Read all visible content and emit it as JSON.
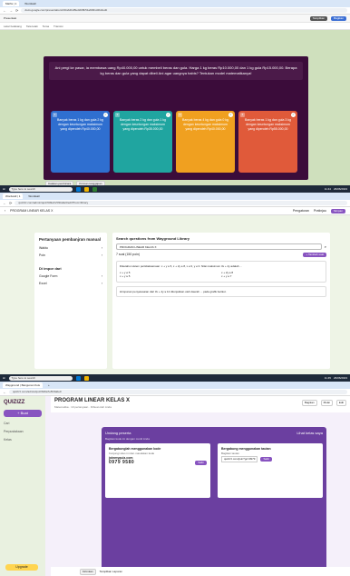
{
  "p1": {
    "tabs": [
      "Maths | 1",
      "Wordwall"
    ],
    "url": "docs.google.com/presentation/d/1fab4bdf9e0db8b51a8d91d4bd/edit",
    "slidebar": {
      "left": "Presentasi",
      "share": "Bagikan",
      "slideshow": "Tampilkan"
    },
    "toolbar": [
      "Latar belakang",
      "Tata letak",
      "Tema",
      "Transisi"
    ],
    "question": "Ani pergi ke pasar, ia membawa uang Rp40.000,00 untuk membeli beras dan gula. Harga 1 kg beras Rp10.000,00 dan 1 kg gula Rp15.000,00. Berapa kg beras dan gula yang dapat dibeli Ani agar uangnya habis? Tentukan model matematikanya!",
    "cards": [
      {
        "num": "1",
        "text": "Banyak beras 1 kg dan gula 2 kg dengan keuntungan maksimum yang diperoleh Rp40.000,00",
        "color": "#2f6fd0"
      },
      {
        "num": "2",
        "text": "Banyak beras 2 kg dan gula 1 kg dengan keuntungan maksimum yang diperoleh Rp35.000,00",
        "color": "#20a5a0"
      },
      {
        "num": "3",
        "text": "Banyak beras 4 kg dan gula 0 kg dengan keuntungan maksimum yang diperoleh Rp40.000,00",
        "color": "#f0a020"
      },
      {
        "num": "4",
        "text": "Banyak beras 1 kg dan gula 3 kg dengan keuntungan maksimum yang diperoleh Rp55.000,00",
        "color": "#e05a3a"
      }
    ],
    "footer": [
      "Catatan pembicara",
      "Kiriman tanggapan"
    ],
    "taskbar": {
      "search": "Type here to search",
      "time": "11:44",
      "date": "26/06/2023"
    }
  },
  "p2": {
    "tabs": [
      "Wordwall | 1",
      "Wordwall"
    ],
    "url": "quizizz.com/admin/quiz/649a7e5f1fa0e0/edit?from=library",
    "head": {
      "title": "PROGRAM LINEAR KELAS X",
      "right": [
        "Pengaturan",
        "Pratinjau",
        "Simpan"
      ]
    },
    "side": {
      "title": "Pertanyaan pembanjran manual",
      "rows": [
        {
          "l": "Waktu",
          "v": "›"
        },
        {
          "l": "Poin",
          "v": "›"
        }
      ],
      "importTitle": "Di impor dari",
      "imports": [
        "Google Form",
        "Excel"
      ]
    },
    "search": {
      "heading": "Search questions from Wayground Library",
      "placeholder": "PROGRAM LINEAR KELAS X",
      "results": "7 soal (150 poin)",
      "add": "+ Tambah soal"
    },
    "questions": [
      {
        "text": "Diketahui sistem pertidaksamaan: x + y ≤ 5, x + 2y ≤ 8, x ≥ 0, y ≥ 0. Nilai maksimum 3x + 4y adalah ...",
        "opts": [
          "x + y ≥ 5",
          "x + 2y ≤ 8",
          "x + y ≤ 5",
          "x + y ≥ 7"
        ]
      },
      {
        "text": "Himpunan penyelesaian dari 3x + 4y ≤ 12 ditunjukkan oleh daerah ... pada grafik berikut."
      }
    ],
    "taskbar": {
      "search": "Type here to search",
      "time": "11:45",
      "date": "26/06/2023"
    }
  },
  "p3": {
    "tabs": [
      "Wayground | Bangunan Kuis",
      "+"
    ],
    "url": "quizizz.com/admin/quiz/649a7e5f1fa0e0",
    "logo": "QUIZIZZ",
    "newBtn": "+ Buat",
    "side": [
      "Cari",
      "Perpustakaan",
      "Kelas"
    ],
    "upgrade": "Upgrade",
    "title": "PROGRAM LINEAR KELAS X",
    "meta": "Matematika · 10 pertanyaan · Dibuat oleh Anda",
    "btns": [
      "Bagikan",
      "Mulai",
      "Edit"
    ],
    "invite": {
      "title": "Undang peserta",
      "sub": "Bagikan kode ini dengan murid Anda",
      "right": "Lihat kelas saya",
      "left": {
        "t": "Bergabunglah menggunakan kode",
        "s": "Kunjungi situs ini dan masukkan kode",
        "site": "joinmyquiz.com",
        "code": "0979 9580",
        "copy": "Salin"
      },
      "rightBox": {
        "t": "Bergabung menggunakan tautan",
        "s": "Bagikan tautan",
        "link": "quizizz.com/join?gc=0979",
        "copy": "Salin"
      }
    },
    "footer": [
      "Kirimkan",
      "Tampilkan Laporan"
    ]
  }
}
